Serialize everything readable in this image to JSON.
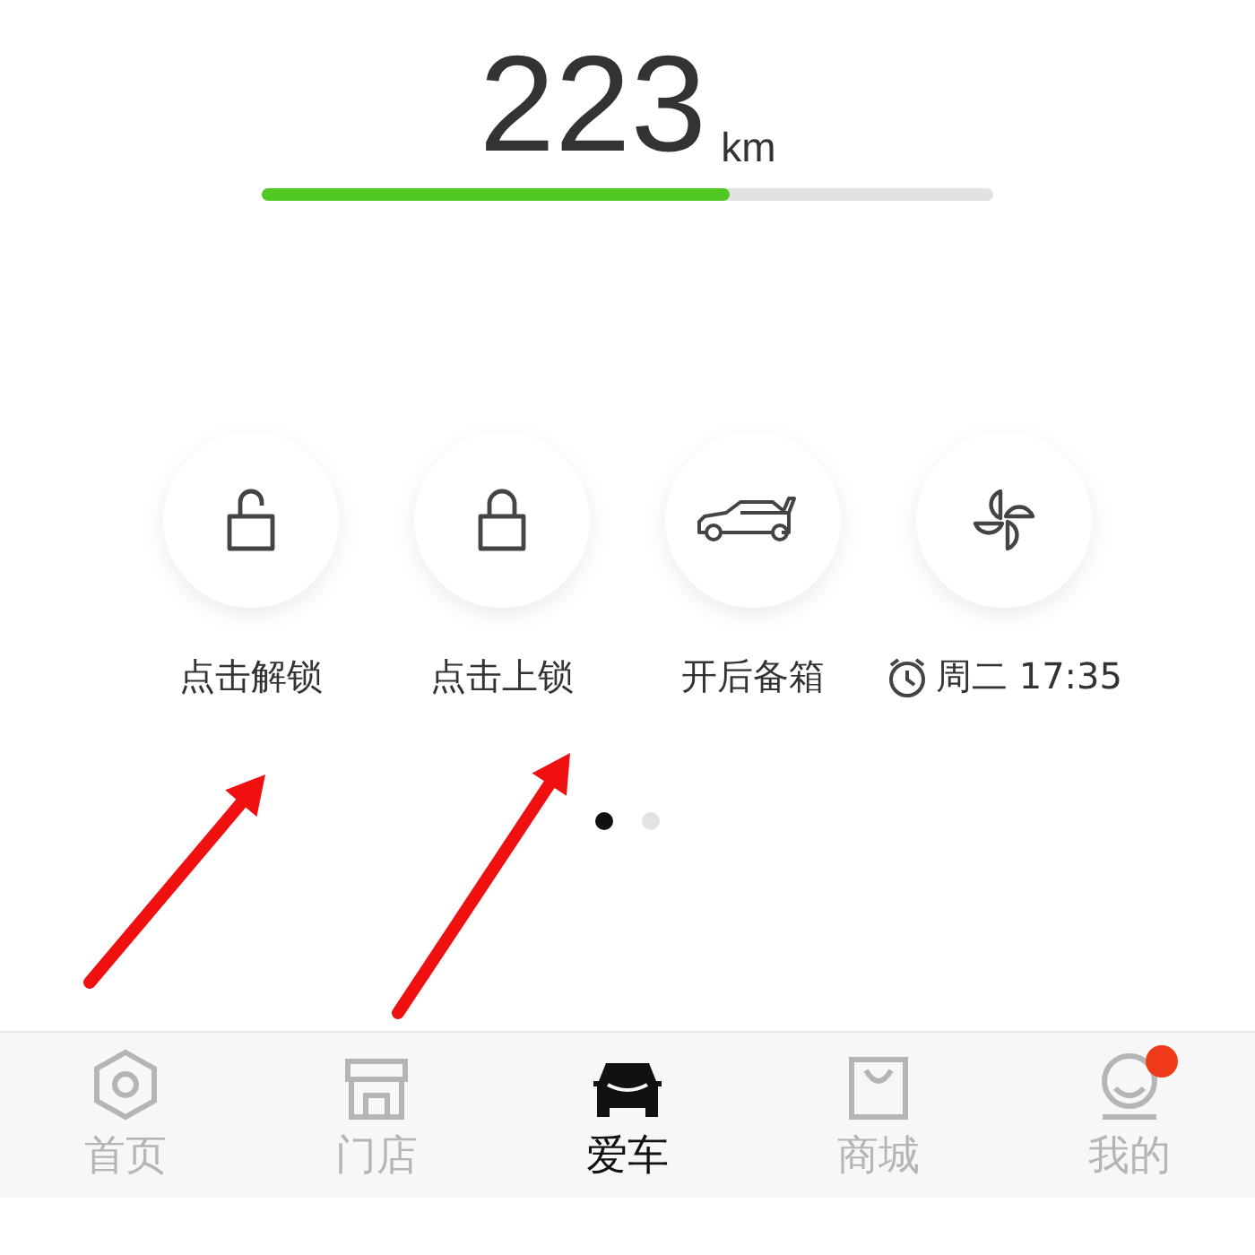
{
  "range": {
    "value": "223",
    "unit": "km",
    "level": 0.64
  },
  "actions": [
    {
      "kind": "unlock",
      "label": "点击解锁"
    },
    {
      "kind": "lock",
      "label": "点击上锁"
    },
    {
      "kind": "trunk",
      "label": "开后备箱"
    },
    {
      "kind": "fan",
      "label": "周二 17:35",
      "alarm": true
    }
  ],
  "pager": [
    {
      "selected": true
    },
    {
      "selected": false
    }
  ],
  "annotations": [
    {
      "kind": "arrow"
    },
    {
      "kind": "arrow"
    }
  ],
  "tabs": [
    {
      "kind": "home",
      "label": "首页",
      "selected": false,
      "badge": false
    },
    {
      "kind": "store",
      "label": "门店",
      "selected": false,
      "badge": false
    },
    {
      "kind": "car",
      "label": "爱车",
      "selected": true,
      "badge": false
    },
    {
      "kind": "shop",
      "label": "商城",
      "selected": false,
      "badge": false
    },
    {
      "kind": "me",
      "label": "我的",
      "selected": false,
      "badge": true
    }
  ]
}
